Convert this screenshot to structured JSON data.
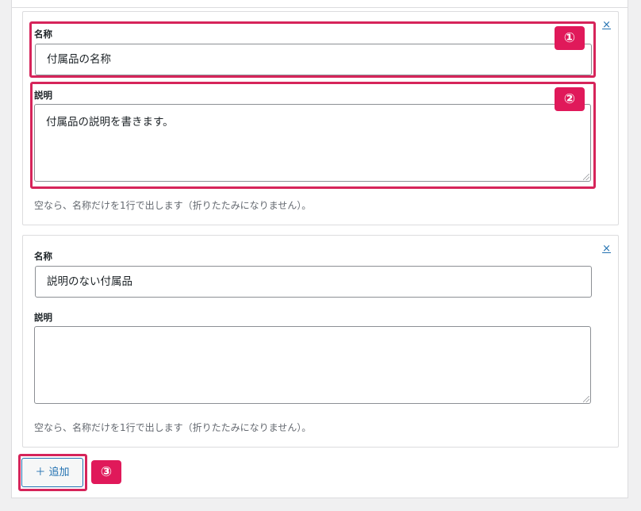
{
  "items": [
    {
      "remove_label": "×",
      "name_label": "名称",
      "name_value": "付属品の名称",
      "desc_label": "説明",
      "desc_value": "付属品の説明を書きます。",
      "hint": "空なら、名称だけを1行で出します（折りたたみになりません）。"
    },
    {
      "remove_label": "×",
      "name_label": "名称",
      "name_value": "説明のない付属品",
      "desc_label": "説明",
      "desc_value": "",
      "hint": "空なら、名称だけを1行で出します（折りたたみになりません）。"
    }
  ],
  "add_button": {
    "label": "＋ 追加"
  },
  "annotations": {
    "badge1": "①",
    "badge2": "②",
    "badge3": "③"
  },
  "colors": {
    "highlight": "#d6245a",
    "badge_bg": "#e0195a",
    "link": "#2271b1"
  }
}
